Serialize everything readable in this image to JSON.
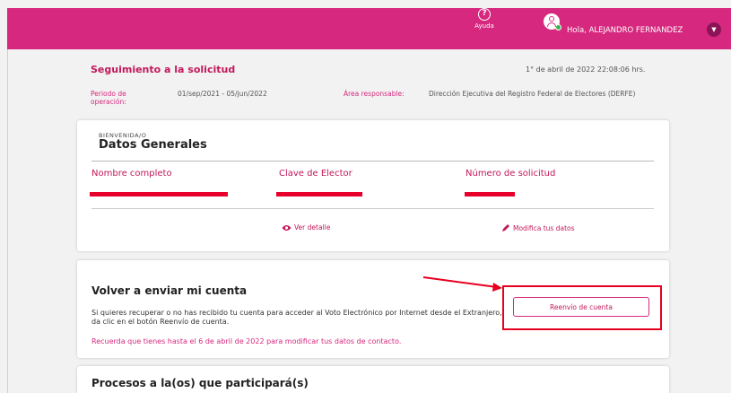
{
  "topbar": {
    "help_label": "Ayuda",
    "greeting": "Hola, ALEJANDRO FERNANDEZ",
    "brand_color": "#d6287e"
  },
  "header": {
    "title": "Seguimiento a la solicitud",
    "date": "1° de abril de 2022 22:08:06 hrs.",
    "period_label": "Periodo de operación:",
    "period_value": "01/sep/2021 - 05/jun/2022",
    "area_label": "Área responsable:",
    "area_value": "Dirección Ejecutiva del Registro Federal de Electores (DERFE)"
  },
  "datos": {
    "welcome": "BIENVENIDA/O",
    "title": "Datos Generales",
    "fields": [
      {
        "label": "Nombre completo"
      },
      {
        "label": "Clave de Elector"
      },
      {
        "label": "Número de solicitud"
      }
    ],
    "ver_detalle": "Ver detalle",
    "modifica": "Modifica tus datos"
  },
  "reenvio": {
    "title": "Volver a enviar mi cuenta",
    "description": "Si quieres recuperar o no has recibido tu cuenta para acceder al Voto Electrónico por Internet desde el Extranjero, da clic en el botón Reenvío de cuenta.",
    "note": "Recuerda que tienes hasta el 6 de abril de 2022 para modificar tus datos de contacto.",
    "button": "Reenvío de cuenta"
  },
  "procesos": {
    "title": "Procesos a la(os) que participará(s)"
  },
  "icons": [
    "help-icon",
    "avatar-icon",
    "chevron-down-icon",
    "eye-icon",
    "pencil-icon"
  ],
  "annotation_color": "#e6001e"
}
